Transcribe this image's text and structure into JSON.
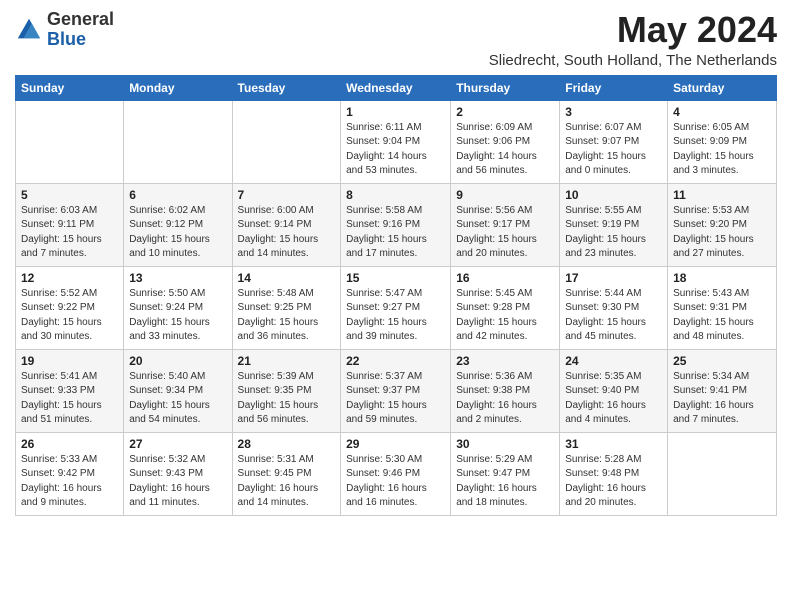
{
  "header": {
    "logo_general": "General",
    "logo_blue": "Blue",
    "month_title": "May 2024",
    "location": "Sliedrecht, South Holland, The Netherlands"
  },
  "days_of_week": [
    "Sunday",
    "Monday",
    "Tuesday",
    "Wednesday",
    "Thursday",
    "Friday",
    "Saturday"
  ],
  "weeks": [
    [
      {
        "day": "",
        "info": ""
      },
      {
        "day": "",
        "info": ""
      },
      {
        "day": "",
        "info": ""
      },
      {
        "day": "1",
        "info": "Sunrise: 6:11 AM\nSunset: 9:04 PM\nDaylight: 14 hours and 53 minutes."
      },
      {
        "day": "2",
        "info": "Sunrise: 6:09 AM\nSunset: 9:06 PM\nDaylight: 14 hours and 56 minutes."
      },
      {
        "day": "3",
        "info": "Sunrise: 6:07 AM\nSunset: 9:07 PM\nDaylight: 15 hours and 0 minutes."
      },
      {
        "day": "4",
        "info": "Sunrise: 6:05 AM\nSunset: 9:09 PM\nDaylight: 15 hours and 3 minutes."
      }
    ],
    [
      {
        "day": "5",
        "info": "Sunrise: 6:03 AM\nSunset: 9:11 PM\nDaylight: 15 hours and 7 minutes."
      },
      {
        "day": "6",
        "info": "Sunrise: 6:02 AM\nSunset: 9:12 PM\nDaylight: 15 hours and 10 minutes."
      },
      {
        "day": "7",
        "info": "Sunrise: 6:00 AM\nSunset: 9:14 PM\nDaylight: 15 hours and 14 minutes."
      },
      {
        "day": "8",
        "info": "Sunrise: 5:58 AM\nSunset: 9:16 PM\nDaylight: 15 hours and 17 minutes."
      },
      {
        "day": "9",
        "info": "Sunrise: 5:56 AM\nSunset: 9:17 PM\nDaylight: 15 hours and 20 minutes."
      },
      {
        "day": "10",
        "info": "Sunrise: 5:55 AM\nSunset: 9:19 PM\nDaylight: 15 hours and 23 minutes."
      },
      {
        "day": "11",
        "info": "Sunrise: 5:53 AM\nSunset: 9:20 PM\nDaylight: 15 hours and 27 minutes."
      }
    ],
    [
      {
        "day": "12",
        "info": "Sunrise: 5:52 AM\nSunset: 9:22 PM\nDaylight: 15 hours and 30 minutes."
      },
      {
        "day": "13",
        "info": "Sunrise: 5:50 AM\nSunset: 9:24 PM\nDaylight: 15 hours and 33 minutes."
      },
      {
        "day": "14",
        "info": "Sunrise: 5:48 AM\nSunset: 9:25 PM\nDaylight: 15 hours and 36 minutes."
      },
      {
        "day": "15",
        "info": "Sunrise: 5:47 AM\nSunset: 9:27 PM\nDaylight: 15 hours and 39 minutes."
      },
      {
        "day": "16",
        "info": "Sunrise: 5:45 AM\nSunset: 9:28 PM\nDaylight: 15 hours and 42 minutes."
      },
      {
        "day": "17",
        "info": "Sunrise: 5:44 AM\nSunset: 9:30 PM\nDaylight: 15 hours and 45 minutes."
      },
      {
        "day": "18",
        "info": "Sunrise: 5:43 AM\nSunset: 9:31 PM\nDaylight: 15 hours and 48 minutes."
      }
    ],
    [
      {
        "day": "19",
        "info": "Sunrise: 5:41 AM\nSunset: 9:33 PM\nDaylight: 15 hours and 51 minutes."
      },
      {
        "day": "20",
        "info": "Sunrise: 5:40 AM\nSunset: 9:34 PM\nDaylight: 15 hours and 54 minutes."
      },
      {
        "day": "21",
        "info": "Sunrise: 5:39 AM\nSunset: 9:35 PM\nDaylight: 15 hours and 56 minutes."
      },
      {
        "day": "22",
        "info": "Sunrise: 5:37 AM\nSunset: 9:37 PM\nDaylight: 15 hours and 59 minutes."
      },
      {
        "day": "23",
        "info": "Sunrise: 5:36 AM\nSunset: 9:38 PM\nDaylight: 16 hours and 2 minutes."
      },
      {
        "day": "24",
        "info": "Sunrise: 5:35 AM\nSunset: 9:40 PM\nDaylight: 16 hours and 4 minutes."
      },
      {
        "day": "25",
        "info": "Sunrise: 5:34 AM\nSunset: 9:41 PM\nDaylight: 16 hours and 7 minutes."
      }
    ],
    [
      {
        "day": "26",
        "info": "Sunrise: 5:33 AM\nSunset: 9:42 PM\nDaylight: 16 hours and 9 minutes."
      },
      {
        "day": "27",
        "info": "Sunrise: 5:32 AM\nSunset: 9:43 PM\nDaylight: 16 hours and 11 minutes."
      },
      {
        "day": "28",
        "info": "Sunrise: 5:31 AM\nSunset: 9:45 PM\nDaylight: 16 hours and 14 minutes."
      },
      {
        "day": "29",
        "info": "Sunrise: 5:30 AM\nSunset: 9:46 PM\nDaylight: 16 hours and 16 minutes."
      },
      {
        "day": "30",
        "info": "Sunrise: 5:29 AM\nSunset: 9:47 PM\nDaylight: 16 hours and 18 minutes."
      },
      {
        "day": "31",
        "info": "Sunrise: 5:28 AM\nSunset: 9:48 PM\nDaylight: 16 hours and 20 minutes."
      },
      {
        "day": "",
        "info": ""
      }
    ]
  ]
}
